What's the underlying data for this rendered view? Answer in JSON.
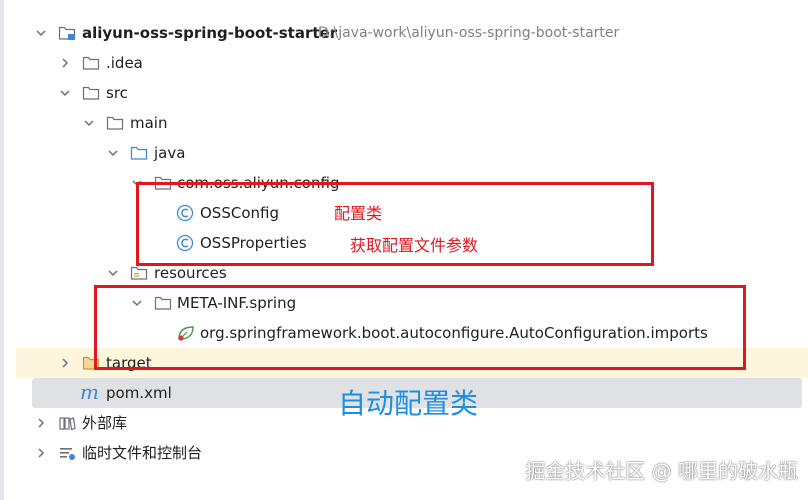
{
  "tree": {
    "project": {
      "name": "aliyun-oss-spring-boot-starter",
      "path": "D:\\java-work\\aliyun-oss-spring-boot-starter"
    },
    "idea": ".idea",
    "src": "src",
    "main": "main",
    "java": "java",
    "package": "com.oss.aliyun.config",
    "oss_config": "OSSConfig",
    "oss_properties": "OSSProperties",
    "resources": "resources",
    "meta_inf": "META-INF.spring",
    "imports_file": "org.springframework.boot.autoconfigure.AutoConfiguration.imports",
    "target": "target",
    "pom": "pom.xml",
    "external_libraries": "外部库",
    "scratches": "临时文件和控制台"
  },
  "annotations": {
    "config_class": "配置类",
    "properties_note": "获取配置文件参数",
    "auto_config": "自动配置类"
  },
  "watermark": "掘金技术社区 @ 哪里的破水瓶",
  "colors": {
    "annotation_red": "#e2161f",
    "annotation_blue": "#1f8ede",
    "class_icon": "#3f88d3",
    "selection": "#dfe1e5",
    "excluded_bg": "#fdf6dd"
  }
}
